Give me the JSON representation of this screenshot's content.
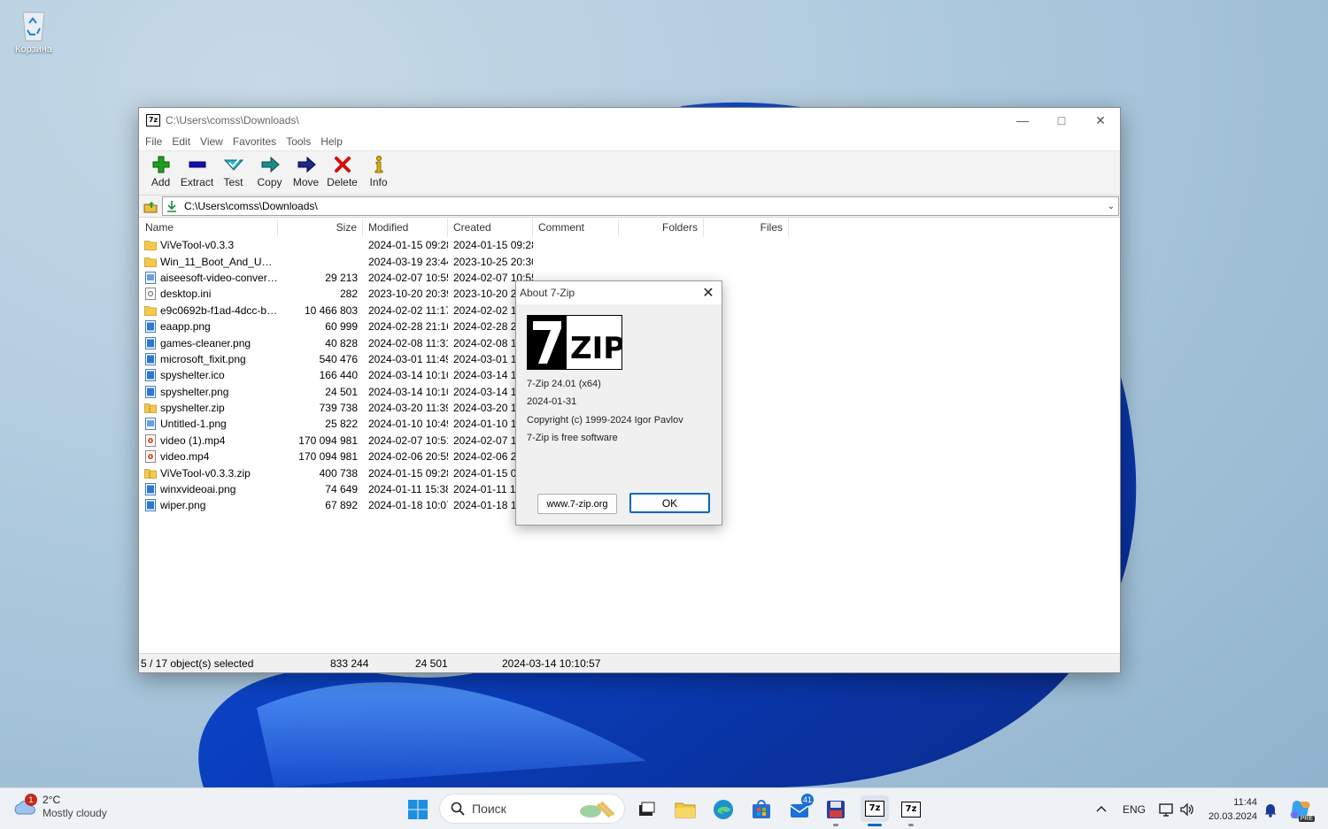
{
  "desktop": {
    "recycle_bin_label": "Корзина"
  },
  "window": {
    "title": "C:\\Users\\comss\\Downloads\\",
    "app_icon_text": "7z",
    "menu": [
      "File",
      "Edit",
      "View",
      "Favorites",
      "Tools",
      "Help"
    ],
    "toolbar": [
      {
        "label": "Add",
        "icon": "add-icon"
      },
      {
        "label": "Extract",
        "icon": "extract-icon"
      },
      {
        "label": "Test",
        "icon": "test-icon"
      },
      {
        "label": "Copy",
        "icon": "copy-icon"
      },
      {
        "label": "Move",
        "icon": "move-icon"
      },
      {
        "label": "Delete",
        "icon": "delete-icon"
      },
      {
        "label": "Info",
        "icon": "info-icon"
      }
    ],
    "address": "C:\\Users\\comss\\Downloads\\",
    "columns": {
      "name": "Name",
      "size": "Size",
      "modified": "Modified",
      "created": "Created",
      "comment": "Comment",
      "folders": "Folders",
      "files": "Files"
    },
    "files": [
      {
        "name": "ViVeTool-v0.3.3",
        "size": "",
        "modified": "2024-01-15 09:28",
        "created": "2024-01-15 09:28",
        "type": "folder"
      },
      {
        "name": "Win_11_Boot_And_Upgr...",
        "size": "",
        "modified": "2024-03-19 23:44",
        "created": "2023-10-25 20:30",
        "type": "folder"
      },
      {
        "name": "aiseesoft-video-convert...",
        "size": "29 213",
        "modified": "2024-02-07 10:55",
        "created": "2024-02-07 10:55",
        "type": "file"
      },
      {
        "name": "desktop.ini",
        "size": "282",
        "modified": "2023-10-20 20:39",
        "created": "2023-10-20 20",
        "type": "ini"
      },
      {
        "name": "e9c0692b-f1ad-4dcc-bf...",
        "size": "10 466 803",
        "modified": "2024-02-02 11:17",
        "created": "2024-02-02 11",
        "type": "folder"
      },
      {
        "name": "eaapp.png",
        "size": "60 999",
        "modified": "2024-02-28 21:16",
        "created": "2024-02-28 21",
        "type": "image"
      },
      {
        "name": "games-cleaner.png",
        "size": "40 828",
        "modified": "2024-02-08 11:31",
        "created": "2024-02-08 11",
        "type": "image"
      },
      {
        "name": "microsoft_fixit.png",
        "size": "540 476",
        "modified": "2024-03-01 11:49",
        "created": "2024-03-01 11",
        "type": "image"
      },
      {
        "name": "spyshelter.ico",
        "size": "166 440",
        "modified": "2024-03-14 10:10",
        "created": "2024-03-14 10",
        "type": "image"
      },
      {
        "name": "spyshelter.png",
        "size": "24 501",
        "modified": "2024-03-14 10:10",
        "created": "2024-03-14 10",
        "type": "image"
      },
      {
        "name": "spyshelter.zip",
        "size": "739 738",
        "modified": "2024-03-20 11:39",
        "created": "2024-03-20 11",
        "type": "zip"
      },
      {
        "name": "Untitled-1.png",
        "size": "25 822",
        "modified": "2024-01-10 10:49",
        "created": "2024-01-10 10",
        "type": "file"
      },
      {
        "name": "video (1).mp4",
        "size": "170 094 981",
        "modified": "2024-02-07 10:51",
        "created": "2024-02-07 10",
        "type": "video"
      },
      {
        "name": "video.mp4",
        "size": "170 094 981",
        "modified": "2024-02-06 20:55",
        "created": "2024-02-06 20",
        "type": "video"
      },
      {
        "name": "ViVeTool-v0.3.3.zip",
        "size": "400 738",
        "modified": "2024-01-15 09:28",
        "created": "2024-01-15 09",
        "type": "zip"
      },
      {
        "name": "winxvideoai.png",
        "size": "74 649",
        "modified": "2024-01-11 15:38",
        "created": "2024-01-11 15",
        "type": "image"
      },
      {
        "name": "wiper.png",
        "size": "67 892",
        "modified": "2024-01-18 10:07",
        "created": "2024-01-18 10",
        "type": "image"
      }
    ],
    "status": {
      "selection": "5 / 17 object(s) selected",
      "total_size": "833 244",
      "item_size": "24 501",
      "item_date": "2024-03-14 10:10:57"
    }
  },
  "about": {
    "title": "About 7-Zip",
    "logo_text": "7ZIP",
    "version": "7-Zip 24.01 (x64)",
    "date": "2024-01-31",
    "copyright": "Copyright (c) 1999-2024 Igor Pavlov",
    "license": "7-Zip is free software",
    "website_button": "www.7-zip.org",
    "ok_button": "OK"
  },
  "taskbar": {
    "weather_temp": "2°C",
    "weather_cond": "Mostly cloudy",
    "weather_badge": "1",
    "search_placeholder": "Поиск",
    "mail_badge": "41",
    "lang": "ENG",
    "time": "11:44",
    "date": "20.03.2024",
    "copilot_label": "PRE"
  },
  "colors": {
    "accent": "#0067c0",
    "add_green": "#1e9e1e",
    "delete_red": "#d01010",
    "extract_blue": "#1010b0"
  }
}
